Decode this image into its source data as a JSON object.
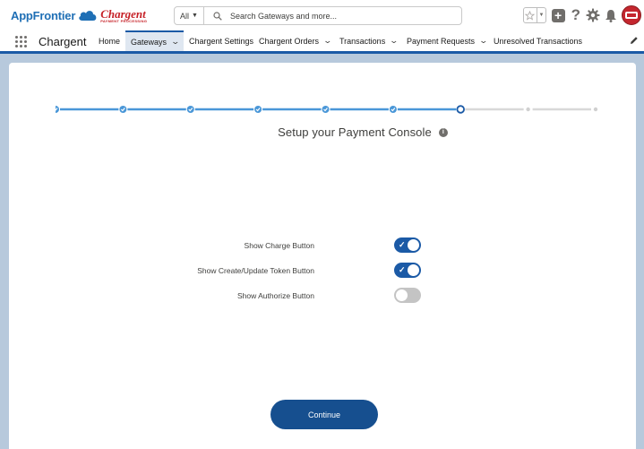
{
  "branding": {
    "app_frontier": "AppFrontier",
    "chargent": "Chargent",
    "chargent_tagline": "PAYMENT PROCESSING"
  },
  "search": {
    "scope": "All",
    "placeholder": "Search Gateways and more..."
  },
  "header_icons": [
    "star-icon",
    "chevron-down-icon",
    "plus-icon",
    "help-icon",
    "gear-icon",
    "bell-icon",
    "avatar"
  ],
  "nav": {
    "app_name": "Chargent",
    "items": [
      {
        "label": "Home",
        "has_menu": false,
        "active": false
      },
      {
        "label": "Gateways",
        "has_menu": true,
        "active": true
      },
      {
        "label": "Chargent Settings",
        "has_menu": false,
        "active": false
      },
      {
        "label": "Chargent Orders",
        "has_menu": true,
        "active": false
      },
      {
        "label": "Transactions",
        "has_menu": true,
        "active": false
      },
      {
        "label": "Payment Requests",
        "has_menu": true,
        "active": false
      },
      {
        "label": "Unresolved Transactions",
        "has_menu": false,
        "active": false
      }
    ]
  },
  "wizard": {
    "total_steps": 9,
    "completed_steps": 6,
    "current_step": 7,
    "title": "Setup your Payment Console",
    "options": [
      {
        "label": "Show Charge Button",
        "enabled": true
      },
      {
        "label": "Show Create/Update Token Button",
        "enabled": true
      },
      {
        "label": "Show Authorize Button",
        "enabled": false
      }
    ],
    "continue_label": "Continue"
  },
  "colors": {
    "brand_blue": "#1b5aa6",
    "button_blue": "#164f8f",
    "progress_blue": "#4a97d8",
    "toggle_off": "#c4c4c4",
    "background": "#b7c9dc"
  }
}
